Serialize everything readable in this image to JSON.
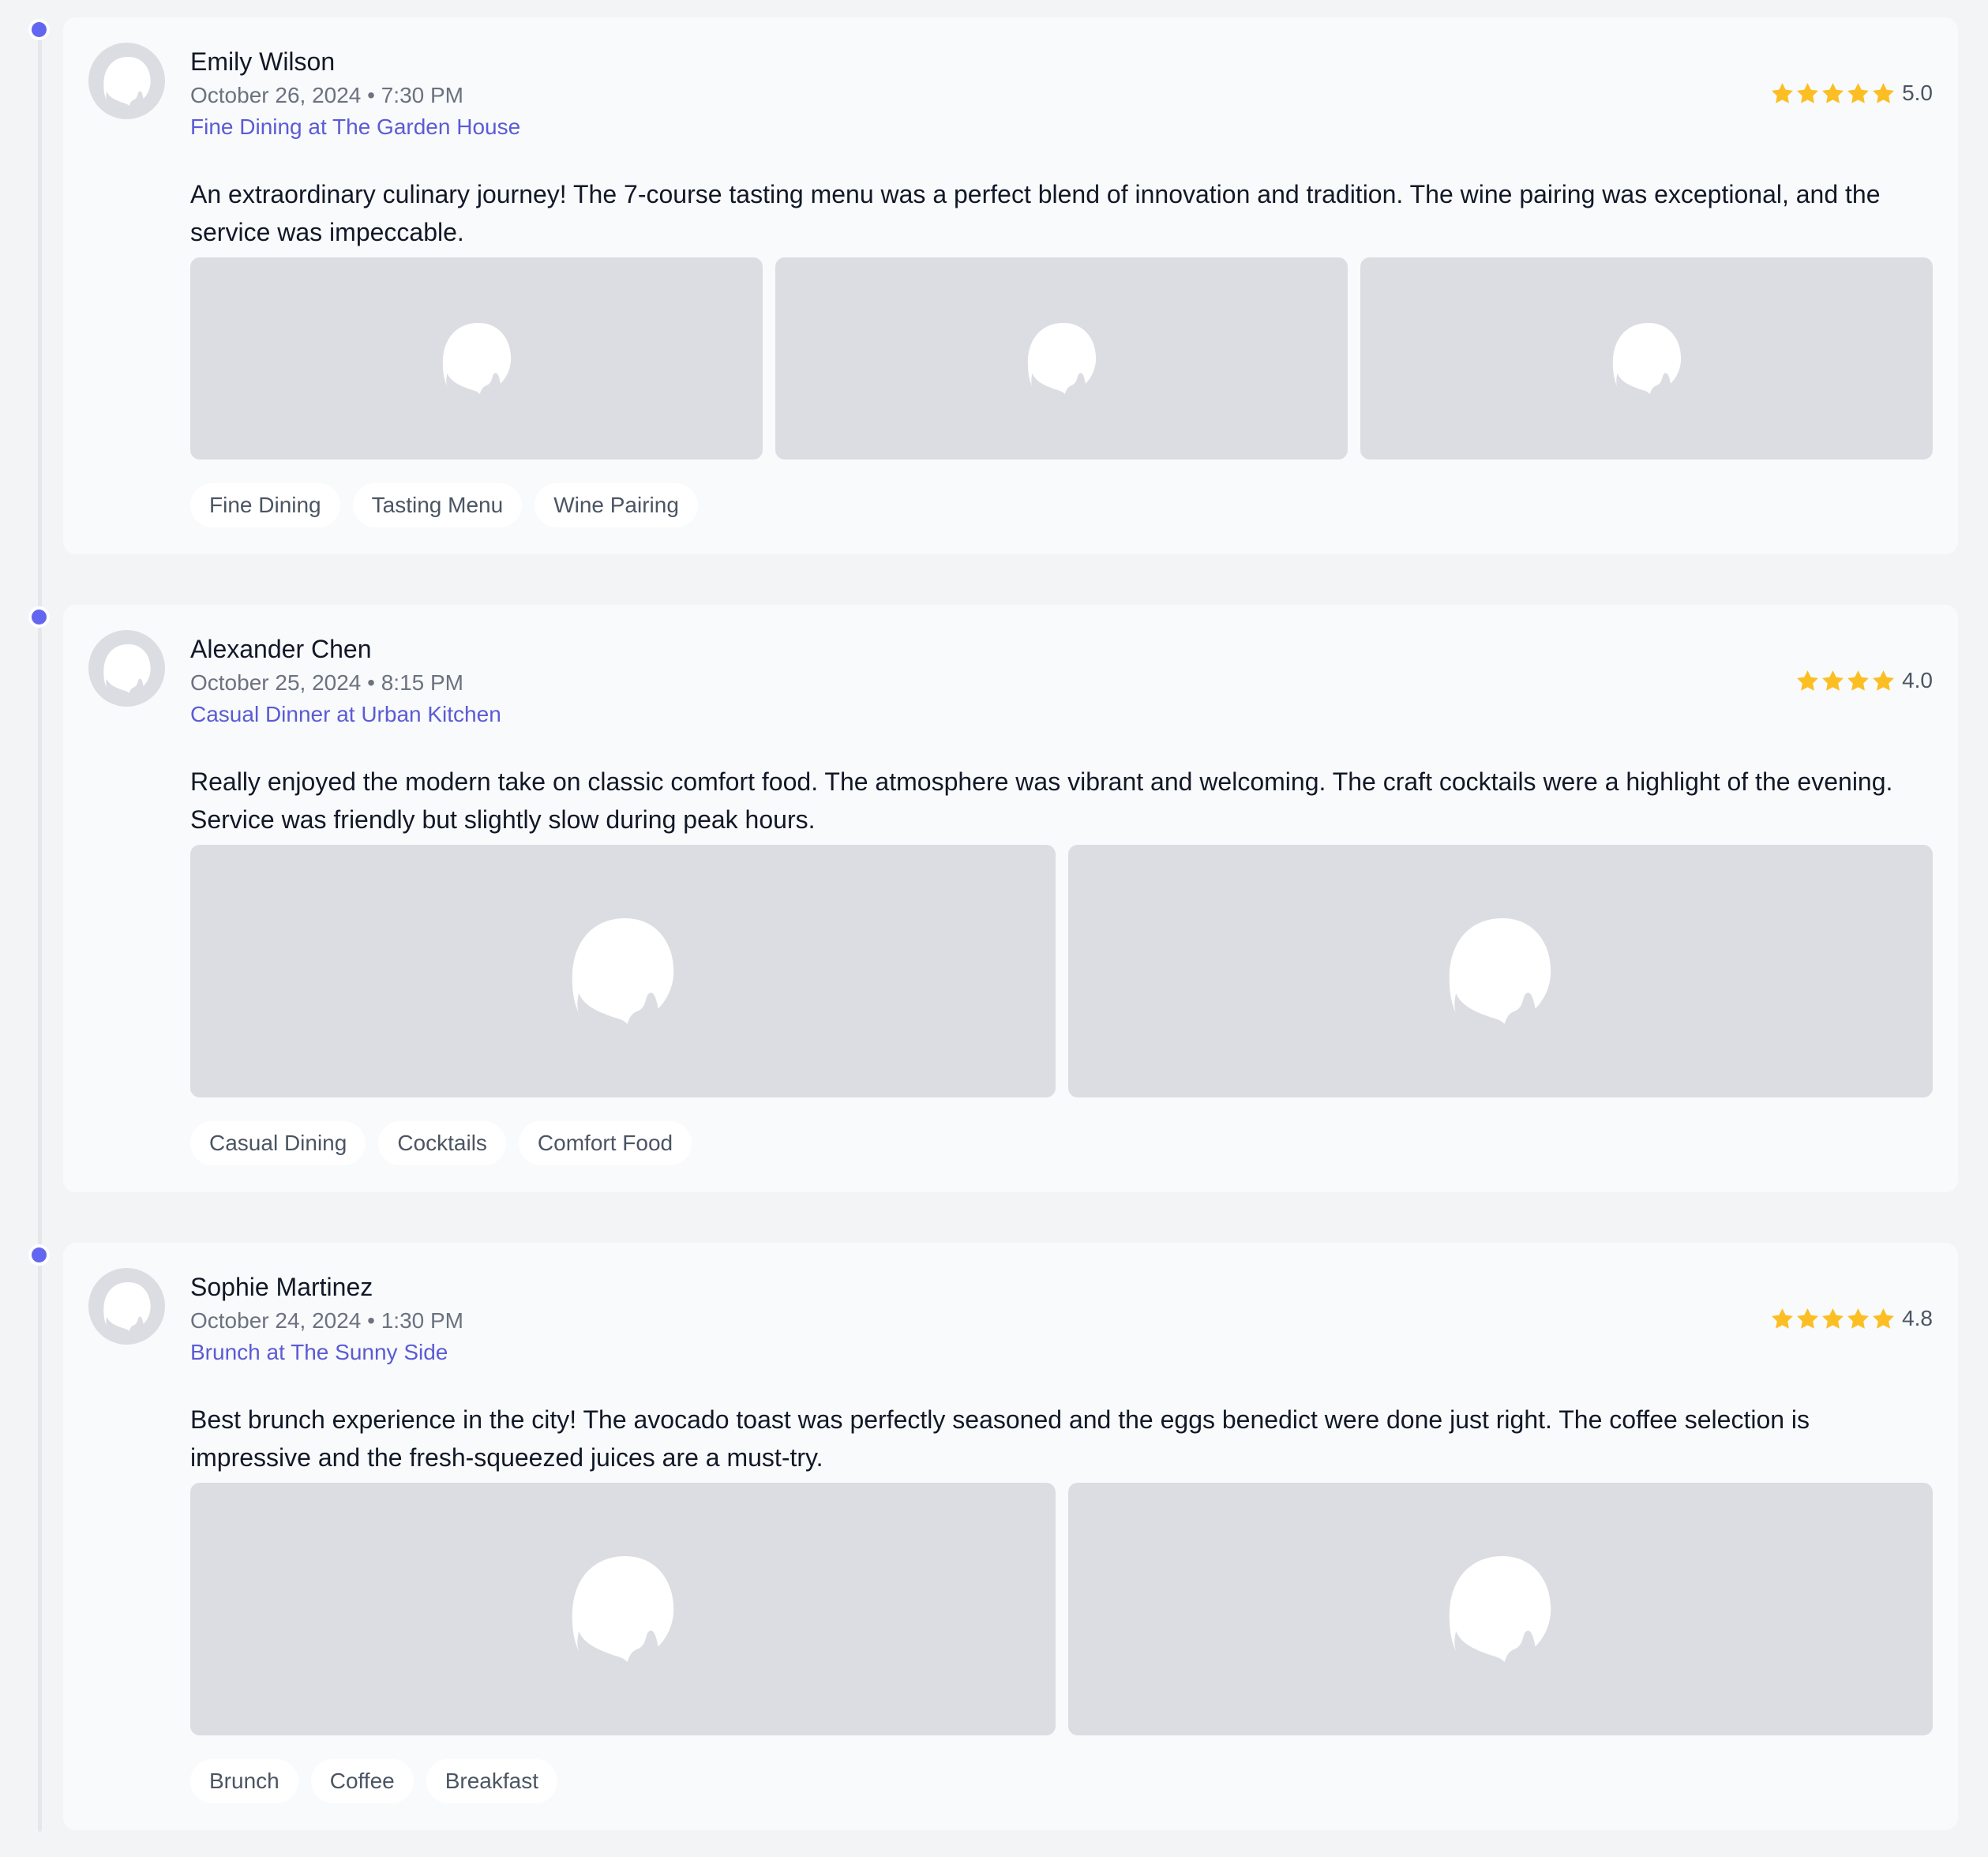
{
  "colors": {
    "accent": "#6366f1",
    "venue_link": "#5b5bd6",
    "star": "#fbbf24",
    "placeholder_bg": "#dcdde2",
    "card_bg": "#f9fafb",
    "page_bg": "#f3f4f6"
  },
  "icons": {
    "avatar": "image-placeholder-icon",
    "photo": "image-placeholder-icon",
    "rating": "star-icon"
  },
  "reviews": [
    {
      "author": "Emily Wilson",
      "date": "October 26, 2024",
      "time": "7:30 PM",
      "meta": "October 26, 2024 • 7:30 PM",
      "venue": "Fine Dining at The Garden House",
      "stars_shown": 5,
      "rating": "5.0",
      "text": "An extraordinary culinary journey! The 7-course tasting menu was a perfect blend of innovation and tradition. The wine pairing was exceptional, and the service was impeccable.",
      "photo_count": 3,
      "tags": [
        "Fine Dining",
        "Tasting Menu",
        "Wine Pairing"
      ]
    },
    {
      "author": "Alexander Chen",
      "date": "October 25, 2024",
      "time": "8:15 PM",
      "meta": "October 25, 2024 • 8:15 PM",
      "venue": "Casual Dinner at Urban Kitchen",
      "stars_shown": 4,
      "rating": "4.0",
      "text": "Really enjoyed the modern take on classic comfort food. The atmosphere was vibrant and welcoming. The craft cocktails were a highlight of the evening. Service was friendly but slightly slow during peak hours.",
      "photo_count": 2,
      "tags": [
        "Casual Dining",
        "Cocktails",
        "Comfort Food"
      ]
    },
    {
      "author": "Sophie Martinez",
      "date": "October 24, 2024",
      "time": "1:30 PM",
      "meta": "October 24, 2024 • 1:30 PM",
      "venue": "Brunch at The Sunny Side",
      "stars_shown": 5,
      "rating": "4.8",
      "text": "Best brunch experience in the city! The avocado toast was perfectly seasoned and the eggs benedict were done just right. The coffee selection is impressive and the fresh-squeezed juices are a must-try.",
      "photo_count": 2,
      "tags": [
        "Brunch",
        "Coffee",
        "Breakfast"
      ]
    }
  ]
}
